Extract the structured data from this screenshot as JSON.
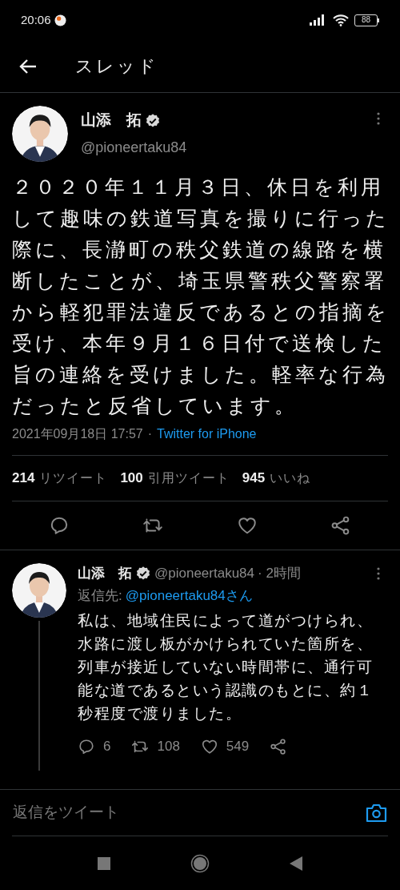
{
  "status_bar": {
    "time": "20:06",
    "battery": "88"
  },
  "header": {
    "title": "スレッド"
  },
  "tweet": {
    "name": "山添　拓",
    "verified": true,
    "handle": "@pioneertaku84",
    "text": "２０２０年１１月３日、休日を利用して趣味の鉄道写真を撮りに行った際に、長瀞町の秩父鉄道の線路を横断したことが、埼玉県警秩父警察署から軽犯罪法違反であるとの指摘を受け、本年９月１６日付で送検した旨の連絡を受けました。軽率な行為だったと反省しています。",
    "timestamp": "2021年09月18日 17:57",
    "separator": "·",
    "source": "Twitter for iPhone",
    "stats": [
      {
        "count": "214",
        "label": "リツイート"
      },
      {
        "count": "100",
        "label": "引用ツイート"
      },
      {
        "count": "945",
        "label": "いいね"
      }
    ]
  },
  "reply": {
    "name": "山添　拓",
    "verified": true,
    "handle": "@pioneertaku84",
    "time": "· 2時間",
    "reply_to_label": "返信先:",
    "reply_to": "@pioneertaku84さん",
    "text": "私は、地域住民によって道がつけられ、水路に渡し板がかけられていた箇所を、列車が接近していない時間帯に、通行可能な道であるという認識のもとに、約１秒程度で渡りました。",
    "actions": [
      {
        "kind": "reply",
        "count": "6"
      },
      {
        "kind": "retweet",
        "count": "108"
      },
      {
        "kind": "like",
        "count": "549"
      },
      {
        "kind": "share"
      }
    ]
  },
  "compose": {
    "placeholder": "返信をツイート"
  }
}
